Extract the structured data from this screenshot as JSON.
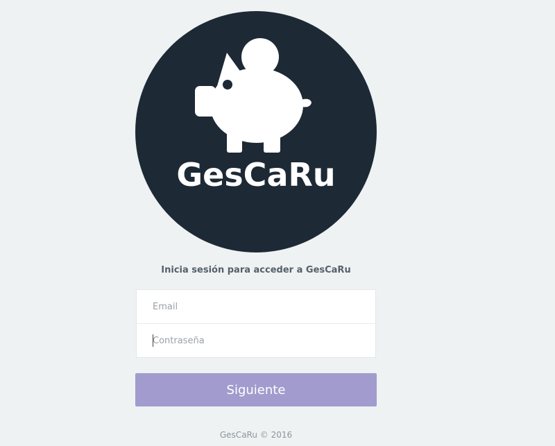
{
  "brand": {
    "logo_icon": "piggy-bank-icon",
    "name": "GesCaRu",
    "circle_color": "#1d2935"
  },
  "login": {
    "subtitle": "Inicia sesión para acceder a GesCaRu",
    "email_placeholder": "Email",
    "email_value": "",
    "password_placeholder": "Contraseña",
    "password_value": "",
    "submit_label": "Siguiente",
    "submit_color": "#a29bce"
  },
  "footer": {
    "text": "GesCaRu © 2016"
  }
}
